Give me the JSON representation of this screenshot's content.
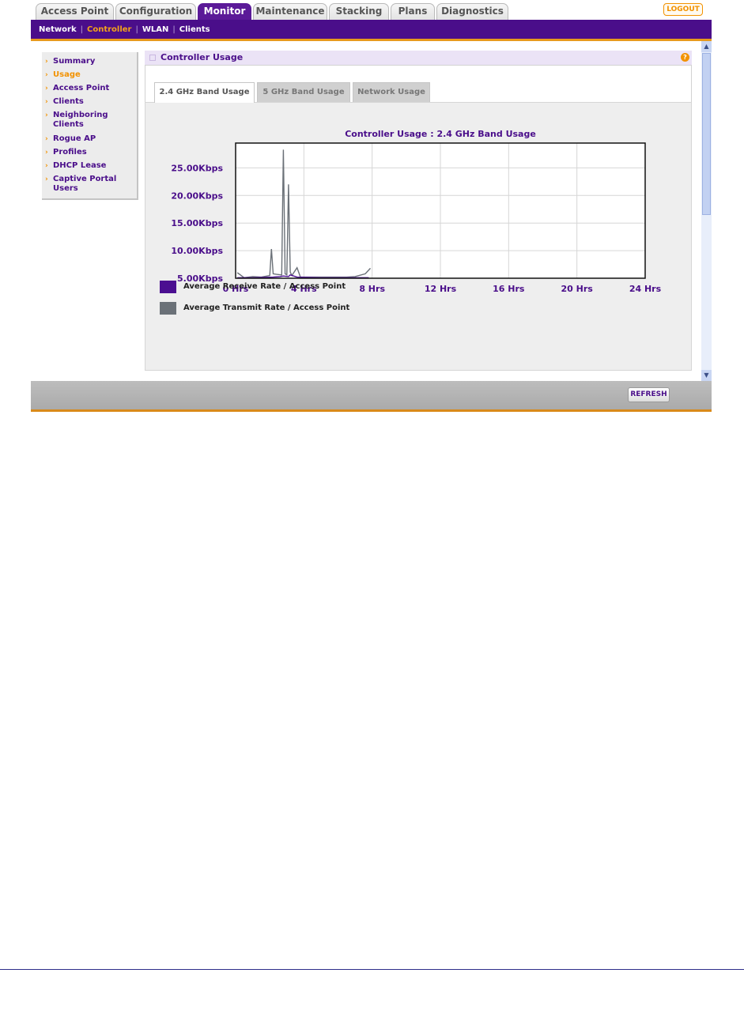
{
  "top_tabs": [
    "Access Point",
    "Configuration",
    "Monitor",
    "Maintenance",
    "Stacking",
    "Plans",
    "Diagnostics"
  ],
  "active_top_tab": "Monitor",
  "logout_label": "LOGOUT",
  "sub_nav": [
    "Network",
    "Controller",
    "WLAN",
    "Clients"
  ],
  "active_sub_nav": "Controller",
  "left_menu": [
    "Summary",
    "Usage",
    "Access Point",
    "Clients",
    "Neighboring Clients",
    "Rogue AP",
    "Profiles",
    "DHCP Lease",
    "Captive Portal Users"
  ],
  "active_left_menu": "Usage",
  "panel": {
    "title": "Controller Usage",
    "help_icon": "?"
  },
  "band_tabs": [
    "2.4 GHz Band Usage",
    "5 GHz Band Usage",
    "Network Usage"
  ],
  "active_band_tab": "2.4 GHz Band Usage",
  "footer": {
    "refresh_label": "REFRESH"
  },
  "colors": {
    "brand_purple": "#4a0e8a",
    "accent_orange": "#f29200",
    "receive": "#4b0f91",
    "transmit": "#6b7178"
  },
  "chart_data": {
    "type": "line",
    "title": "Controller Usage : 2.4 GHz Band Usage",
    "xlabel": "",
    "ylabel": "",
    "x_ticks": [
      "0 Hrs",
      "4 Hrs",
      "8 Hrs",
      "12 Hrs",
      "16 Hrs",
      "20 Hrs",
      "24 Hrs"
    ],
    "y_ticks": [
      "5.00Kbps",
      "10.00Kbps",
      "15.00Kbps",
      "20.00Kbps",
      "25.00Kbps"
    ],
    "xlim": [
      0,
      24
    ],
    "ylim": [
      5,
      29.5
    ],
    "grid": true,
    "legend_position": "bottom-left",
    "series": [
      {
        "name": "Average Receive Rate / Access Point",
        "color": "#4b0f91",
        "x": [
          0.1,
          1.0,
          2.2,
          2.6,
          2.8,
          3.1,
          3.2,
          3.6,
          5.0,
          7.8
        ],
        "y": [
          5.1,
          5.1,
          5.2,
          5.3,
          5.4,
          5.3,
          5.6,
          5.2,
          5.1,
          5.1
        ]
      },
      {
        "name": "Average Transmit Rate / Access Point",
        "color": "#6b7178",
        "x": [
          0.1,
          0.5,
          1.0,
          1.5,
          2.0,
          2.1,
          2.2,
          2.4,
          2.7,
          2.8,
          2.9,
          3.0,
          3.1,
          3.2,
          3.3,
          3.6,
          3.8,
          6.5,
          7.0,
          7.6,
          7.9
        ],
        "y": [
          6.0,
          5.1,
          5.3,
          5.2,
          5.5,
          10.3,
          5.8,
          5.7,
          5.6,
          28.3,
          5.8,
          5.6,
          22.0,
          6.1,
          5.5,
          6.9,
          5.2,
          5.2,
          5.3,
          5.8,
          6.8
        ]
      }
    ]
  }
}
